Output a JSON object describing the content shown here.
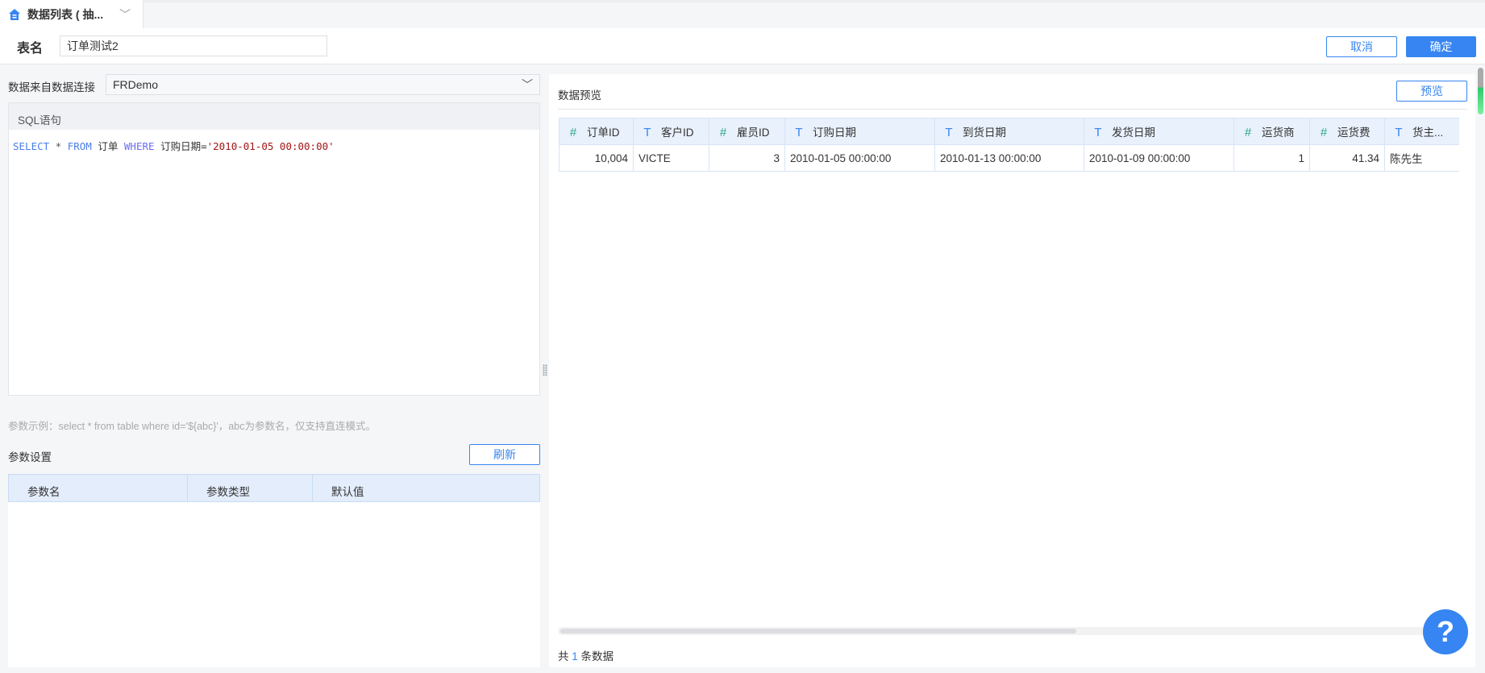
{
  "tab": {
    "title": "数据列表 ( 抽...",
    "icon": "home-icon"
  },
  "header": {
    "label": "表名",
    "table_name": "订单测试2",
    "cancel": "取消",
    "confirm": "确定"
  },
  "left": {
    "source_label": "数据来自数据连接",
    "connection": "FRDemo",
    "sql_title": "SQL语句",
    "sql": {
      "kw1": "SELECT",
      "star": " * ",
      "kw2": "FROM",
      "t1": " 订单 ",
      "kw3": "WHERE",
      "t2": " 订购日期=",
      "str": "'2010-01-05 00:00:00'"
    },
    "hint": "参数示例：select * from table where id='${abc}'，abc为参数名，仅支持直连模式。",
    "params_title": "参数设置",
    "refresh": "刷新",
    "param_columns": [
      "参数名",
      "参数类型",
      "默认值"
    ]
  },
  "right": {
    "title": "数据预览",
    "preview": "预览",
    "columns": [
      {
        "name": "订单ID",
        "type": "#"
      },
      {
        "name": "客户ID",
        "type": "T"
      },
      {
        "name": "雇员ID",
        "type": "#"
      },
      {
        "name": "订购日期",
        "type": "T"
      },
      {
        "name": "到货日期",
        "type": "T"
      },
      {
        "name": "发货日期",
        "type": "T"
      },
      {
        "name": "运货商",
        "type": "#"
      },
      {
        "name": "运货费",
        "type": "#"
      },
      {
        "name": "货主...",
        "type": "T"
      }
    ],
    "rows": [
      [
        "10,004",
        "VICTE",
        "3",
        "2010-01-05 00:00:00",
        "2010-01-13 00:00:00",
        "2010-01-09 00:00:00",
        "1",
        "41.34",
        "陈先生"
      ]
    ],
    "footer": {
      "prefix": "共 ",
      "count": "1",
      "suffix": " 条数据"
    }
  },
  "help": "?"
}
